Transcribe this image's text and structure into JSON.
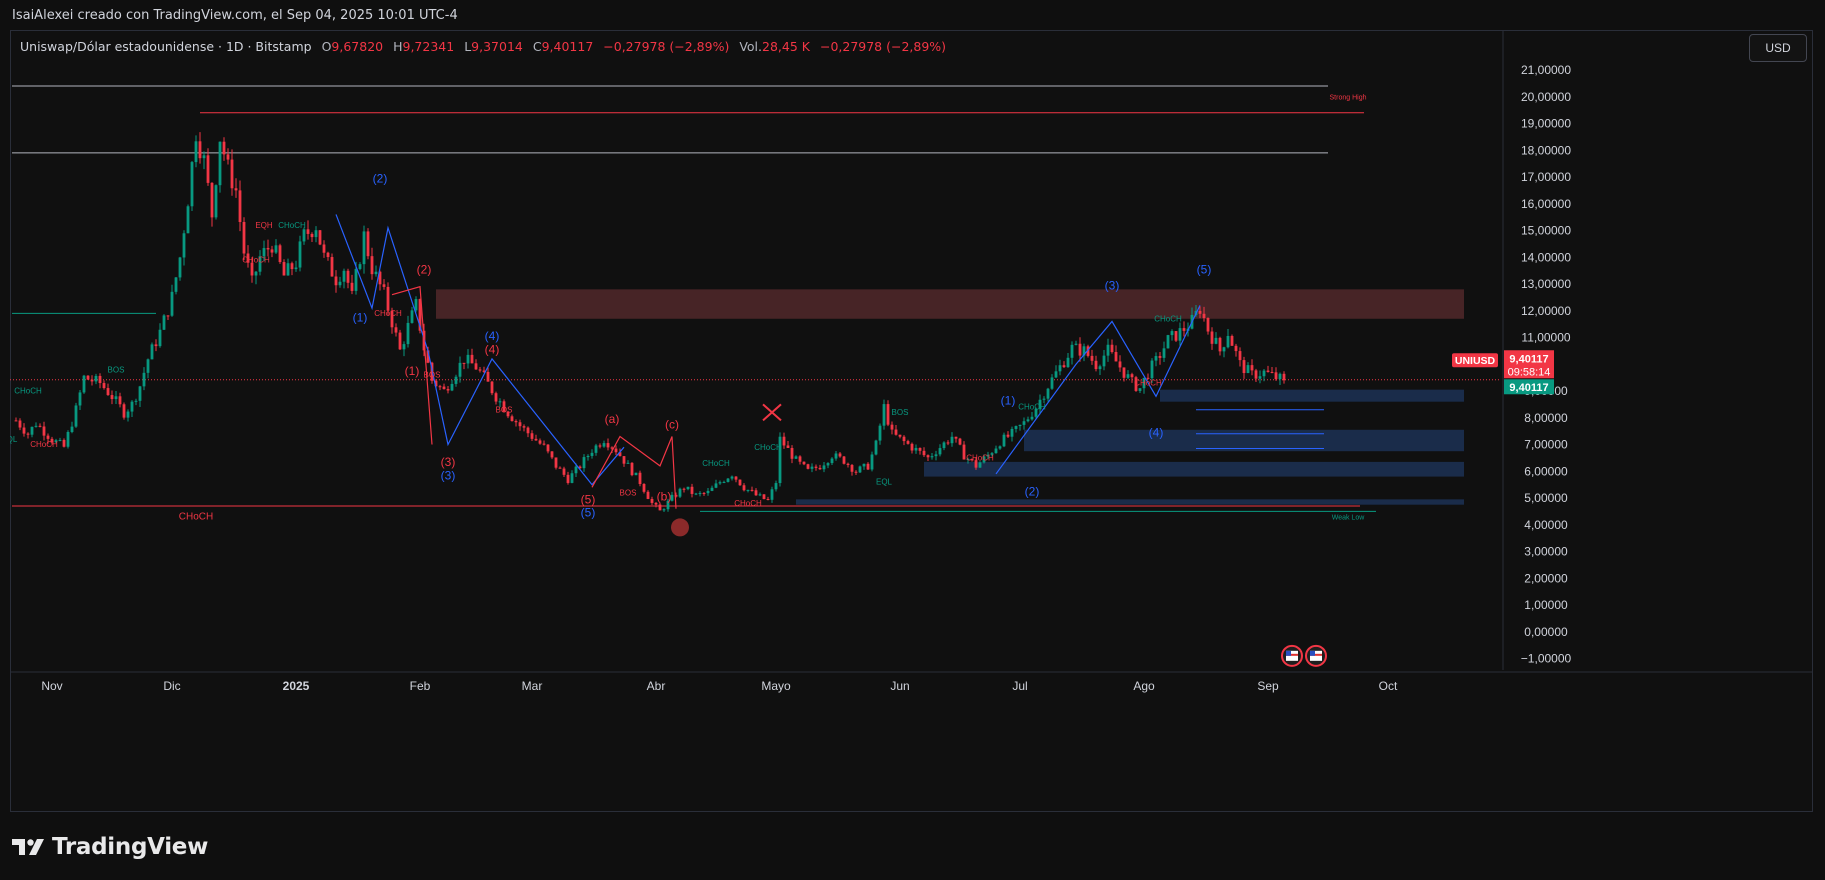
{
  "header": {
    "text": "IsaiAlexei creado con TradingView.com, el Sep 04, 2025 10:01 UTC-4"
  },
  "legend": {
    "symbol": "Uniswap/Dólar estadounidense · 1D · Bitstamp",
    "o_label": "O",
    "o_value": "9,67820",
    "h_label": "H",
    "h_value": "9,72341",
    "l_label": "L",
    "l_value": "9,37014",
    "c_label": "C",
    "c_value": "9,40117",
    "change": "−0,27978 (−2,89%)",
    "vol_label": "Vol.",
    "vol_value": "28,45 K",
    "vol_change": "−0,27978 (−2,89%)"
  },
  "currency_button": "USD",
  "footer": {
    "brand": "TradingView"
  },
  "colors": {
    "up": "#089981",
    "down": "#f23645",
    "blue": "#2962ff",
    "background": "#0f0f0f",
    "zone_red": "#5a2b2e",
    "zone_blue": "#1b2e4e"
  },
  "chart_data": {
    "type": "candlestick",
    "symbol": "UNIUSD",
    "ylim": [
      -1.3,
      21.5
    ],
    "y_ticks": [
      {
        "v": 21,
        "label": "21,00000"
      },
      {
        "v": 20,
        "label": "20,00000"
      },
      {
        "v": 19,
        "label": "19,00000"
      },
      {
        "v": 18,
        "label": "18,00000"
      },
      {
        "v": 17,
        "label": "17,00000"
      },
      {
        "v": 16,
        "label": "16,00000"
      },
      {
        "v": 15,
        "label": "15,00000"
      },
      {
        "v": 14,
        "label": "14,00000"
      },
      {
        "v": 13,
        "label": "13,00000"
      },
      {
        "v": 12,
        "label": "12,00000"
      },
      {
        "v": 11,
        "label": "11,00000"
      },
      {
        "v": 9,
        "label": "9,00000"
      },
      {
        "v": 8,
        "label": "8,00000"
      },
      {
        "v": 7,
        "label": "7,00000"
      },
      {
        "v": 6,
        "label": "6,00000"
      },
      {
        "v": 5,
        "label": "5,00000"
      },
      {
        "v": 4,
        "label": "4,00000"
      },
      {
        "v": 3,
        "label": "3,00000"
      },
      {
        "v": 2,
        "label": "2,00000"
      },
      {
        "v": 1,
        "label": "1,00000"
      },
      {
        "v": 0,
        "label": "0,00000"
      },
      {
        "v": -1,
        "label": "−1,00000"
      }
    ],
    "x_ticks": [
      {
        "day": 0,
        "label": "Nov"
      },
      {
        "day": 30,
        "label": "Dic"
      },
      {
        "day": 61,
        "label": "2025"
      },
      {
        "day": 92,
        "label": "Feb"
      },
      {
        "day": 120,
        "label": "Mar"
      },
      {
        "day": 151,
        "label": "Abr"
      },
      {
        "day": 181,
        "label": "Mayo"
      },
      {
        "day": 212,
        "label": "Jun"
      },
      {
        "day": 242,
        "label": "Jul"
      },
      {
        "day": 273,
        "label": "Ago"
      },
      {
        "day": 304,
        "label": "Sep"
      },
      {
        "day": 334,
        "label": "Oct"
      }
    ],
    "last_price": {
      "value": 9.40117,
      "label": "9,40117",
      "countdown": "09:58:14",
      "tag": "UNIUSD"
    },
    "close_marker": {
      "value": 9.40117,
      "label": "9,40117"
    },
    "path": [
      [
        -9,
        7.9
      ],
      [
        -6,
        7.4
      ],
      [
        -4,
        7.8
      ],
      [
        0,
        7.2
      ],
      [
        3,
        6.9
      ],
      [
        6,
        8.3
      ],
      [
        8,
        9.5
      ],
      [
        12,
        9.3
      ],
      [
        15,
        8.8
      ],
      [
        18,
        8.2
      ],
      [
        20,
        8.5
      ],
      [
        22,
        9.2
      ],
      [
        24,
        10.2
      ],
      [
        27,
        11.2
      ],
      [
        30,
        12.5
      ],
      [
        32,
        14.0
      ],
      [
        34,
        16.2
      ],
      [
        36,
        18.7
      ],
      [
        38,
        17.6
      ],
      [
        40,
        15.6
      ],
      [
        42,
        18.5
      ],
      [
        44,
        17.3
      ],
      [
        46,
        16.5
      ],
      [
        48,
        14.2
      ],
      [
        50,
        13.0
      ],
      [
        52,
        14.0
      ],
      [
        55,
        14.5
      ],
      [
        58,
        13.3
      ],
      [
        61,
        13.8
      ],
      [
        63,
        14.8
      ],
      [
        66,
        15.2
      ],
      [
        68,
        14.0
      ],
      [
        71,
        13.2
      ],
      [
        73,
        13.6
      ],
      [
        75,
        12.5
      ],
      [
        78,
        14.8
      ],
      [
        80,
        13.6
      ],
      [
        83,
        12.6
      ],
      [
        85,
        11.6
      ],
      [
        87,
        10.5
      ],
      [
        89,
        11.4
      ],
      [
        91,
        12.2
      ],
      [
        93,
        10.6
      ],
      [
        95,
        9.4
      ],
      [
        98,
        9.0
      ],
      [
        100,
        9.5
      ],
      [
        103,
        10.2
      ],
      [
        106,
        9.9
      ],
      [
        108,
        9.5
      ],
      [
        111,
        8.8
      ],
      [
        114,
        8.2
      ],
      [
        117,
        7.7
      ],
      [
        120,
        7.3
      ],
      [
        123,
        6.9
      ],
      [
        126,
        6.2
      ],
      [
        129,
        5.7
      ],
      [
        132,
        6.2
      ],
      [
        135,
        6.8
      ],
      [
        138,
        7.2
      ],
      [
        141,
        6.8
      ],
      [
        144,
        6.2
      ],
      [
        147,
        5.6
      ],
      [
        150,
        4.8
      ],
      [
        152,
        4.5
      ],
      [
        155,
        5.0
      ],
      [
        158,
        5.4
      ],
      [
        161,
        5.1
      ],
      [
        164,
        5.2
      ],
      [
        167,
        5.6
      ],
      [
        170,
        5.9
      ],
      [
        173,
        5.4
      ],
      [
        176,
        5.1
      ],
      [
        179,
        4.9
      ],
      [
        181,
        5.6
      ],
      [
        182,
        7.2
      ],
      [
        184,
        6.8
      ],
      [
        186,
        6.4
      ],
      [
        189,
        6.0
      ],
      [
        192,
        6.2
      ],
      [
        195,
        6.6
      ],
      [
        198,
        6.4
      ],
      [
        201,
        6.0
      ],
      [
        204,
        6.2
      ],
      [
        206,
        7.0
      ],
      [
        208,
        8.4
      ],
      [
        210,
        7.4
      ],
      [
        213,
        7.1
      ],
      [
        216,
        6.8
      ],
      [
        219,
        6.5
      ],
      [
        222,
        6.9
      ],
      [
        225,
        7.3
      ],
      [
        228,
        6.6
      ],
      [
        231,
        6.2
      ],
      [
        234,
        6.6
      ],
      [
        237,
        7.1
      ],
      [
        240,
        7.4
      ],
      [
        243,
        7.8
      ],
      [
        246,
        8.4
      ],
      [
        249,
        9.2
      ],
      [
        252,
        9.9
      ],
      [
        255,
        10.6
      ],
      [
        258,
        10.5
      ],
      [
        261,
        10.0
      ],
      [
        264,
        10.5
      ],
      [
        267,
        9.9
      ],
      [
        270,
        9.3
      ],
      [
        272,
        9.1
      ],
      [
        274,
        9.7
      ],
      [
        276,
        10.1
      ],
      [
        279,
        10.9
      ],
      [
        282,
        11.2
      ],
      [
        285,
        11.6
      ],
      [
        287,
        12.1
      ],
      [
        289,
        11.3
      ],
      [
        292,
        10.5
      ],
      [
        294,
        11.2
      ],
      [
        297,
        10.0
      ],
      [
        300,
        9.6
      ],
      [
        303,
        9.7
      ],
      [
        306,
        9.5
      ],
      [
        308,
        9.4
      ]
    ],
    "zones": [
      {
        "d1": 96,
        "d2": 353,
        "top": 12.8,
        "bot": 11.7,
        "kind": "red"
      },
      {
        "d1": 277,
        "d2": 353,
        "top": 9.05,
        "bot": 8.6,
        "kind": "blue"
      },
      {
        "d1": 243,
        "d2": 353,
        "top": 7.55,
        "bot": 6.75,
        "kind": "blue"
      },
      {
        "d1": 218,
        "d2": 353,
        "top": 6.35,
        "bot": 5.8,
        "kind": "blue"
      },
      {
        "d1": 186,
        "d2": 353,
        "top": 4.95,
        "bot": 4.75,
        "kind": "blue"
      }
    ],
    "hlines": [
      {
        "d1": -10,
        "d2": 319,
        "v": 20.4,
        "color": "#b2b5be",
        "w": 1
      },
      {
        "d1": 37,
        "d2": 328,
        "v": 19.4,
        "color": "#f23645",
        "w": 1
      },
      {
        "d1": -10,
        "d2": 319,
        "v": 17.9,
        "color": "#b2b5be",
        "w": 1
      },
      {
        "d1": -10,
        "d2": 327,
        "v": 4.7,
        "color": "#f23645",
        "w": 1
      },
      {
        "d1": 162,
        "d2": 331,
        "v": 4.5,
        "color": "#089981",
        "w": 1
      },
      {
        "d1": -10,
        "d2": 26,
        "v": 11.9,
        "color": "#089981",
        "w": 1
      },
      {
        "d1": 286,
        "d2": 318,
        "v": 8.3,
        "color": "#2962ff",
        "w": 1
      },
      {
        "d1": 286,
        "d2": 318,
        "v": 7.4,
        "color": "#2962ff",
        "w": 1
      },
      {
        "d1": 286,
        "d2": 318,
        "v": 6.85,
        "color": "#2962ff",
        "w": 1
      }
    ],
    "dotted_last": {
      "v": 9.42
    },
    "blue_waves": [
      [
        [
          71,
          15.6
        ],
        [
          80,
          12.1
        ],
        [
          84,
          15.1
        ],
        [
          94,
          10.5
        ],
        [
          99,
          7.0
        ],
        [
          110,
          10.2
        ],
        [
          135,
          5.5
        ],
        [
          143,
          6.9
        ]
      ],
      [
        [
          236,
          5.9
        ],
        [
          256,
          10.0
        ],
        [
          265,
          11.6
        ],
        [
          276,
          8.8
        ],
        [
          287,
          12.2
        ]
      ]
    ],
    "red_waves": [
      [
        [
          85,
          12.6
        ],
        [
          92,
          12.9
        ],
        [
          95,
          7.0
        ]
      ],
      [
        [
          135,
          5.4
        ],
        [
          142,
          7.3
        ],
        [
          152,
          6.2
        ],
        [
          155,
          7.3
        ],
        [
          156,
          4.6
        ]
      ]
    ],
    "annotations": [
      {
        "d": 82,
        "v": 16.8,
        "text": "(2)",
        "color": "#2962ff",
        "size": 12
      },
      {
        "d": 77,
        "v": 11.6,
        "text": "(1)",
        "color": "#2962ff",
        "size": 12
      },
      {
        "d": 93,
        "v": 13.4,
        "text": "(2)",
        "color": "#f23645",
        "size": 12
      },
      {
        "d": 90,
        "v": 9.6,
        "text": "(1)",
        "color": "#f23645",
        "size": 12
      },
      {
        "d": 110,
        "v": 10.9,
        "text": "(4)",
        "color": "#2962ff",
        "size": 12
      },
      {
        "d": 110,
        "v": 10.4,
        "text": "(4)",
        "color": "#f23645",
        "size": 12
      },
      {
        "d": 99,
        "v": 6.2,
        "text": "(3)",
        "color": "#f23645",
        "size": 12
      },
      {
        "d": 99,
        "v": 5.7,
        "text": "(3)",
        "color": "#2962ff",
        "size": 12
      },
      {
        "d": 140,
        "v": 7.8,
        "text": "(a)",
        "color": "#f23645",
        "size": 12
      },
      {
        "d": 155,
        "v": 7.6,
        "text": "(c)",
        "color": "#f23645",
        "size": 12
      },
      {
        "d": 134,
        "v": 4.8,
        "text": "(5)",
        "color": "#f23645",
        "size": 12
      },
      {
        "d": 134,
        "v": 4.3,
        "text": "(5)",
        "color": "#2962ff",
        "size": 12
      },
      {
        "d": 153,
        "v": 4.9,
        "text": "(b)",
        "color": "#f23645",
        "size": 12
      },
      {
        "d": 239,
        "v": 8.5,
        "text": "(1)",
        "color": "#2962ff",
        "size": 12
      },
      {
        "d": 245,
        "v": 5.1,
        "text": "(2)",
        "color": "#2962ff",
        "size": 12
      },
      {
        "d": 265,
        "v": 12.8,
        "text": "(3)",
        "color": "#2962ff",
        "size": 12
      },
      {
        "d": 276,
        "v": 7.3,
        "text": "(4)",
        "color": "#2962ff",
        "size": 12
      },
      {
        "d": 288,
        "v": 13.4,
        "text": "(5)",
        "color": "#2962ff",
        "size": 12
      },
      {
        "d": 53,
        "v": 15.1,
        "text": "EQH",
        "color": "#f23645",
        "size": 8
      },
      {
        "d": 60,
        "v": 15.1,
        "text": "CHoCH",
        "color": "#089981",
        "size": 8
      },
      {
        "d": 51,
        "v": 13.8,
        "text": "CHoCH",
        "color": "#f23645",
        "size": 8
      },
      {
        "d": 84,
        "v": 11.8,
        "text": "CHoCH",
        "color": "#f23645",
        "size": 8
      },
      {
        "d": 95,
        "v": 9.5,
        "text": "BOS",
        "color": "#f23645",
        "size": 8
      },
      {
        "d": 113,
        "v": 8.2,
        "text": "BOS",
        "color": "#f23645",
        "size": 8
      },
      {
        "d": 16,
        "v": 9.7,
        "text": "BOS",
        "color": "#089981",
        "size": 8
      },
      {
        "d": -6,
        "v": 8.9,
        "text": "CHoCH",
        "color": "#089981",
        "size": 8
      },
      {
        "d": -2,
        "v": 6.9,
        "text": "CHoCH",
        "color": "#f23645",
        "size": 8
      },
      {
        "d": -10,
        "v": 7.1,
        "text": "QL",
        "color": "#089981",
        "size": 8
      },
      {
        "d": 144,
        "v": 5.1,
        "text": "BOS",
        "color": "#f23645",
        "size": 8
      },
      {
        "d": 166,
        "v": 6.2,
        "text": "CHoCH",
        "color": "#089981",
        "size": 8
      },
      {
        "d": 179,
        "v": 6.8,
        "text": "CHoCH",
        "color": "#089981",
        "size": 8
      },
      {
        "d": 174,
        "v": 4.7,
        "text": "CHoCH",
        "color": "#f23645",
        "size": 8
      },
      {
        "d": 212,
        "v": 8.1,
        "text": "BOS",
        "color": "#089981",
        "size": 8
      },
      {
        "d": 208,
        "v": 5.5,
        "text": "EQL",
        "color": "#089981",
        "size": 8
      },
      {
        "d": 232,
        "v": 6.4,
        "text": "CHoCH",
        "color": "#f23645",
        "size": 8
      },
      {
        "d": 245,
        "v": 8.3,
        "text": "CHoCH",
        "color": "#089981",
        "size": 8
      },
      {
        "d": 274,
        "v": 9.2,
        "text": "CHoCH",
        "color": "#f23645",
        "size": 8
      },
      {
        "d": 279,
        "v": 11.6,
        "text": "CHoCH",
        "color": "#089981",
        "size": 8
      },
      {
        "d": 36,
        "v": 4.2,
        "text": "CHoCH",
        "color": "#f23645",
        "size": 10
      },
      {
        "d": 324,
        "v": 19.9,
        "text": "Strong High",
        "color": "#f23645",
        "size": 7
      },
      {
        "d": 324,
        "v": 4.2,
        "text": "Weak Low",
        "color": "#089981",
        "size": 7
      }
    ],
    "x_marker": {
      "d": 180,
      "v": 8.2
    },
    "circle_marker": {
      "d": 157,
      "v": 3.9
    },
    "flags": [
      {
        "d": 310,
        "v": -0.9
      },
      {
        "d": 316,
        "v": -0.9
      }
    ]
  }
}
